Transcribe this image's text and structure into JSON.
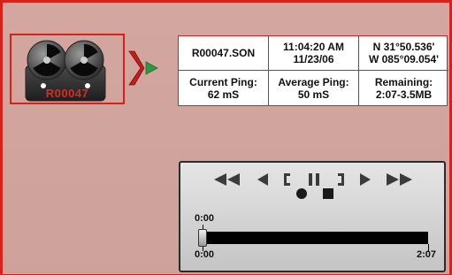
{
  "recording": {
    "file_label": "R00047"
  },
  "info": {
    "filename": "R00047.SON",
    "time": "11:04:20 AM",
    "date": "11/23/06",
    "lat": "N 31°50.536'",
    "lon": "W 085°09.054'",
    "current_ping_label": "Current Ping:",
    "current_ping_value": "62 mS",
    "average_ping_label": "Average Ping:",
    "average_ping_value": "50 mS",
    "remaining_label": "Remaining:",
    "remaining_value": "2:07-3.5MB"
  },
  "player": {
    "controls": [
      "rewind-fast",
      "rewind",
      "mark-in",
      "pause",
      "mark-out",
      "play",
      "fast-forward"
    ],
    "position_time": "0:00",
    "start_time": "0:00",
    "end_time": "2:07",
    "progress_fraction": 0.0
  },
  "colors": {
    "accent_red": "#d8211b",
    "arrow_green": "#2c9a3c",
    "background": "#d1a39d"
  }
}
